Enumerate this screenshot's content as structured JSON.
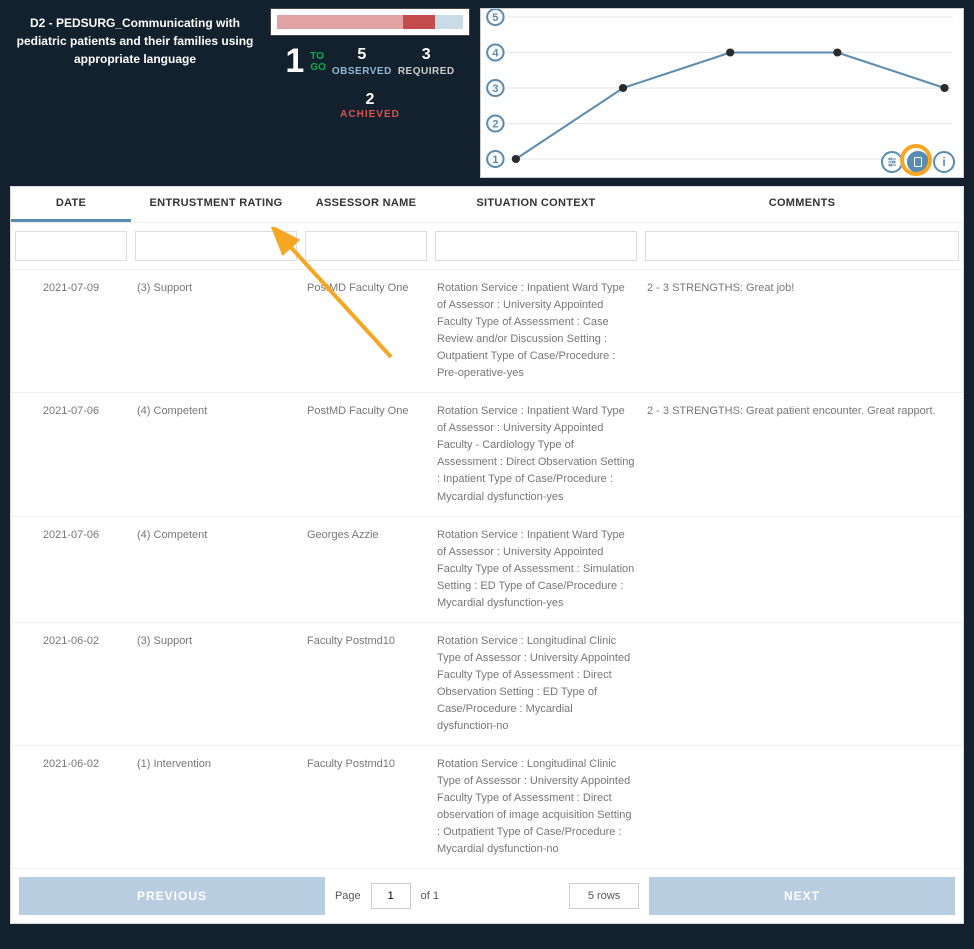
{
  "title": "D2 - PEDSURG_Communicating with pediatric patients and their families using appropriate language",
  "stats": {
    "to_go_value": "1",
    "to_go_label_a": "TO",
    "to_go_label_b": "GO",
    "observed_value": "5",
    "observed_label": "OBSERVED",
    "required_value": "3",
    "required_label": "REQUIRED",
    "achieved_value": "2",
    "achieved_label": "ACHIEVED"
  },
  "chart_data": {
    "type": "line",
    "y_ticks": [
      1,
      2,
      3,
      4,
      5
    ],
    "x": [
      1,
      2,
      3,
      4,
      5
    ],
    "values": [
      1,
      3,
      4,
      4,
      3
    ],
    "title": "",
    "xlabel": "",
    "ylabel": ""
  },
  "columns": {
    "date": "DATE",
    "rating": "ENTRUSTMENT RATING",
    "assessor": "ASSESSOR NAME",
    "context": "SITUATION CONTEXT",
    "comments": "COMMENTS"
  },
  "filters": {
    "date": "",
    "rating": "",
    "assessor": "",
    "context": "",
    "comments": ""
  },
  "rows": [
    {
      "date": "2021-07-09",
      "rating": "(3) Support",
      "assessor": "PostMD Faculty One",
      "context": "Rotation Service : Inpatient Ward Type of Assessor : University Appointed Faculty Type of Assessment : Case Review and/or Discussion Setting : Outpatient Type of Case/Procedure : Pre-operative-yes",
      "comments": "2 - 3 STRENGTHS: Great job!"
    },
    {
      "date": "2021-07-06",
      "rating": "(4) Competent",
      "assessor": "PostMD Faculty One",
      "context": "Rotation Service : Inpatient Ward Type of Assessor : University Appointed Faculty - Cardiology Type of Assessment : Direct Observation Setting : Inpatient Type of Case/Procedure : Mycardial dysfunction-yes",
      "comments": "2 - 3 STRENGTHS: Great patient encounter. Great rapport."
    },
    {
      "date": "2021-07-06",
      "rating": "(4) Competent",
      "assessor": "Georges Azzie",
      "context": "Rotation Service : Inpatient Ward Type of Assessor : University Appointed Faculty Type of Assessment : Simulation Setting : ED Type of Case/Procedure : Mycardial dysfunction-yes",
      "comments": ""
    },
    {
      "date": "2021-06-02",
      "rating": "(3) Support",
      "assessor": "Faculty Postmd10",
      "context": "Rotation Service : Longitudinal Clinic Type of Assessor : University Appointed Faculty Type of Assessment : Direct Observation Setting : ED Type of Case/Procedure : Mycardial dysfunction-no",
      "comments": ""
    },
    {
      "date": "2021-06-02",
      "rating": "(1) Intervention",
      "assessor": "Faculty Postmd10",
      "context": "Rotation Service : Longitudinal Clinic Type of Assessor : University Appointed Faculty Type of Assessment : Direct observation of image acquisition Setting : Outpatient Type of Case/Procedure : Mycardial dysfunction-no",
      "comments": ""
    }
  ],
  "footer": {
    "previous": "PREVIOUS",
    "next": "NEXT",
    "page_label": "Page",
    "page_value": "1",
    "of_label": "of 1",
    "rows_label": "5 rows"
  }
}
